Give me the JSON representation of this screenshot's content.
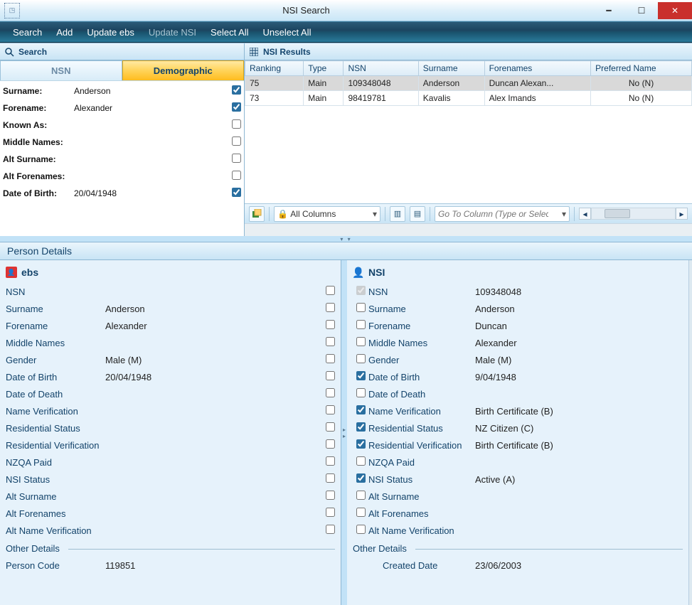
{
  "window": {
    "title": "NSI Search"
  },
  "menu": {
    "search": "Search",
    "add": "Add",
    "update_ebs": "Update ebs",
    "update_nsi": "Update NSI",
    "select_all": "Select All",
    "unselect_all": "Unselect All"
  },
  "search_panel": {
    "header": "Search",
    "tab_nsn": "NSN",
    "tab_demo": "Demographic",
    "fields": {
      "surname_label": "Surname:",
      "surname_value": "Anderson",
      "surname_checked": true,
      "forename_label": "Forename:",
      "forename_value": "Alexander",
      "forename_checked": true,
      "knownas_label": "Known As:",
      "knownas_value": "",
      "knownas_checked": false,
      "middle_label": "Middle Names:",
      "middle_value": "",
      "middle_checked": false,
      "altsurname_label": "Alt Surname:",
      "altsurname_value": "",
      "altsurname_checked": false,
      "altforenames_label": "Alt Forenames:",
      "altforenames_value": "",
      "altforenames_checked": false,
      "dob_label": "Date of Birth:",
      "dob_value": "20/04/1948",
      "dob_checked": true
    }
  },
  "results_panel": {
    "header": "NSI Results",
    "columns": {
      "ranking": "Ranking",
      "type": "Type",
      "nsn": "NSN",
      "surname": "Surname",
      "forenames": "Forenames",
      "preferred": "Preferred Name"
    },
    "rows": [
      {
        "ranking": "75",
        "type": "Main",
        "nsn": "109348048",
        "surname": "Anderson",
        "forenames": "Duncan Alexan...",
        "preferred": "No (N)"
      },
      {
        "ranking": "73",
        "type": "Main",
        "nsn": "98419781",
        "surname": "Kavalis",
        "forenames": "Alex Imands",
        "preferred": "No (N)"
      }
    ],
    "toolbar": {
      "allcols": "All Columns",
      "goto_placeholder": "Go To Column (Type or Select)"
    }
  },
  "person_details": {
    "header": "Person Details",
    "ebs": {
      "title": "ebs",
      "nsn_label": "NSN",
      "nsn_value": "",
      "surname_label": "Surname",
      "surname_value": "Anderson",
      "forename_label": "Forename",
      "forename_value": "Alexander",
      "middle_label": "Middle Names",
      "middle_value": "",
      "gender_label": "Gender",
      "gender_value": "Male (M)",
      "dob_label": "Date of Birth",
      "dob_value": "20/04/1948",
      "dod_label": "Date of Death",
      "dod_value": "",
      "namever_label": "Name Verification",
      "namever_value": "",
      "resstat_label": "Residential Status",
      "resstat_value": "",
      "resver_label": "Residential Verification",
      "resver_value": "",
      "nzqa_label": "NZQA Paid",
      "nzqa_value": "",
      "nsistat_label": "NSI Status",
      "nsistat_value": "",
      "altsurname_label": "Alt Surname",
      "altsurname_value": "",
      "altfore_label": "Alt Forenames",
      "altfore_value": "",
      "altnamever_label": "Alt Name Verification",
      "altnamever_value": "",
      "other_legend": "Other Details",
      "personcode_label": "Person Code",
      "personcode_value": "119851"
    },
    "nsi": {
      "title": "NSI",
      "nsn_label": "NSN",
      "nsn_value": "109348048",
      "nsn_checked": true,
      "surname_label": "Surname",
      "surname_value": "Anderson",
      "surname_checked": false,
      "forename_label": "Forename",
      "forename_value": "Duncan",
      "forename_checked": false,
      "middle_label": "Middle Names",
      "middle_value": "Alexander",
      "middle_checked": false,
      "gender_label": "Gender",
      "gender_value": "Male (M)",
      "gender_checked": false,
      "dob_label": "Date of Birth",
      "dob_value": "9/04/1948",
      "dob_checked": true,
      "dod_label": "Date of Death",
      "dod_value": "",
      "dod_checked": false,
      "namever_label": "Name Verification",
      "namever_value": "Birth Certificate (B)",
      "namever_checked": true,
      "resstat_label": "Residential Status",
      "resstat_value": "NZ Citizen (C)",
      "resstat_checked": true,
      "resver_label": "Residential Verification",
      "resver_value": "Birth Certificate (B)",
      "resver_checked": true,
      "nzqa_label": "NZQA Paid",
      "nzqa_value": "",
      "nzqa_checked": false,
      "nsistat_label": "NSI Status",
      "nsistat_value": "Active (A)",
      "nsistat_checked": true,
      "altsurname_label": "Alt Surname",
      "altsurname_value": "",
      "altsurname_checked": false,
      "altfore_label": "Alt Forenames",
      "altfore_value": "",
      "altfore_checked": false,
      "altnamever_label": "Alt Name Verification",
      "altnamever_value": "",
      "altnamever_checked": false,
      "other_legend": "Other Details",
      "created_label": "Created Date",
      "created_value": "23/06/2003"
    }
  }
}
